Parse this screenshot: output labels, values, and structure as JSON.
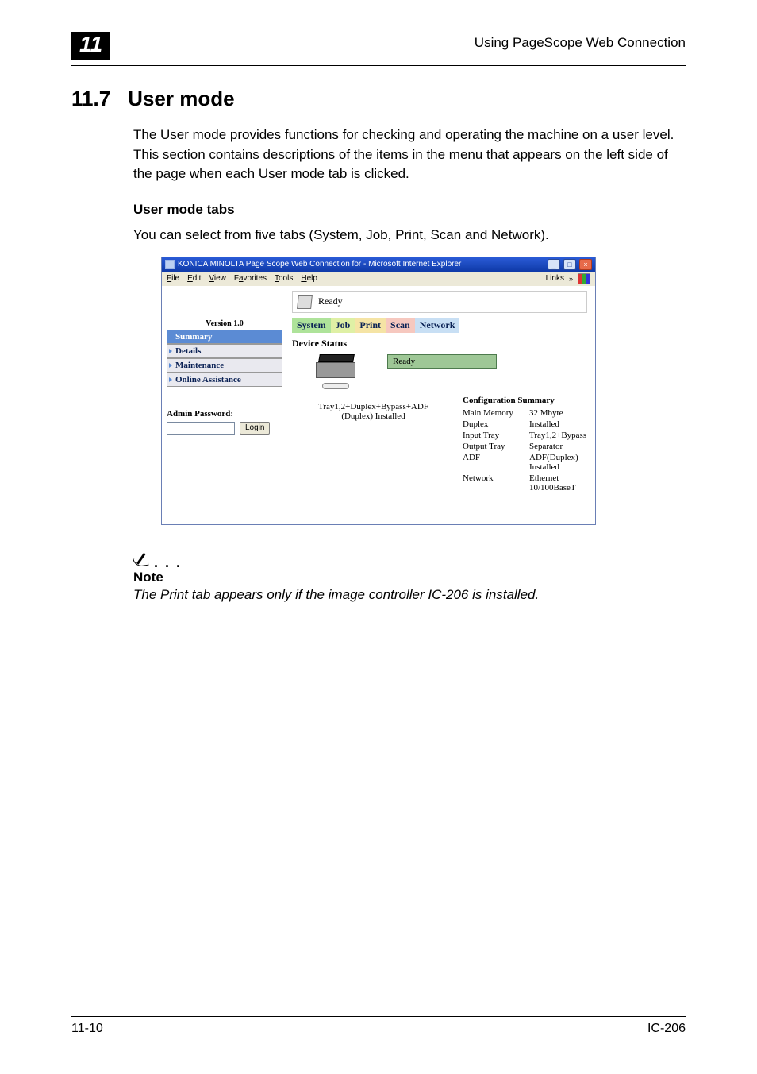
{
  "header": {
    "chapter_num": "11",
    "breadcrumb": "Using PageScope Web Connection"
  },
  "section": {
    "number": "11.7",
    "title": "User mode",
    "intro": "The User mode provides functions for checking and operating the machine on a user level. This section contains descriptions of the items in the menu that appears on the left side of the page when each User mode tab is clicked."
  },
  "subheading": "User mode tabs",
  "subtext": "You can select from five tabs (System, Job, Print, Scan and Network).",
  "screenshot": {
    "window_title": "KONICA MINOLTA Page Scope Web Connection for      - Microsoft Internet Explorer",
    "menubar": {
      "file": "File",
      "edit": "Edit",
      "view": "View",
      "favorites": "Favorites",
      "tools": "Tools",
      "help": "Help",
      "links": "Links"
    },
    "status_ready": "Ready",
    "version": "Version 1.0",
    "nav": {
      "summary": "Summary",
      "details": "Details",
      "maintenance": "Maintenance",
      "online_assistance": "Online Assistance"
    },
    "admin": {
      "label": "Admin Password:",
      "login": "Login"
    },
    "tabs": {
      "system": "System",
      "job": "Job",
      "print": "Print",
      "scan": "Scan",
      "network": "Network"
    },
    "device_status": "Device Status",
    "ready_box": "Ready",
    "tray_text_line1": "Tray1,2+Duplex+Bypass+ADF",
    "tray_text_line2": "(Duplex) Installed",
    "config_title": "Configuration Summary",
    "config": {
      "main_memory_k": "Main Memory",
      "main_memory_v": "32 Mbyte",
      "duplex_k": "Duplex",
      "duplex_v": "Installed",
      "input_tray_k": "Input Tray",
      "input_tray_v": "Tray1,2+Bypass",
      "output_tray_k": "Output Tray",
      "output_tray_v": "Separator",
      "adf_k": "ADF",
      "adf_v": "ADF(Duplex) Installed",
      "network_k": "Network",
      "network_v": "Ethernet 10/100BaseT"
    }
  },
  "note": {
    "label": "Note",
    "text": "The Print tab appears only if the image controller IC-206 is installed."
  },
  "footer": {
    "left": "11-10",
    "right": "IC-206"
  }
}
